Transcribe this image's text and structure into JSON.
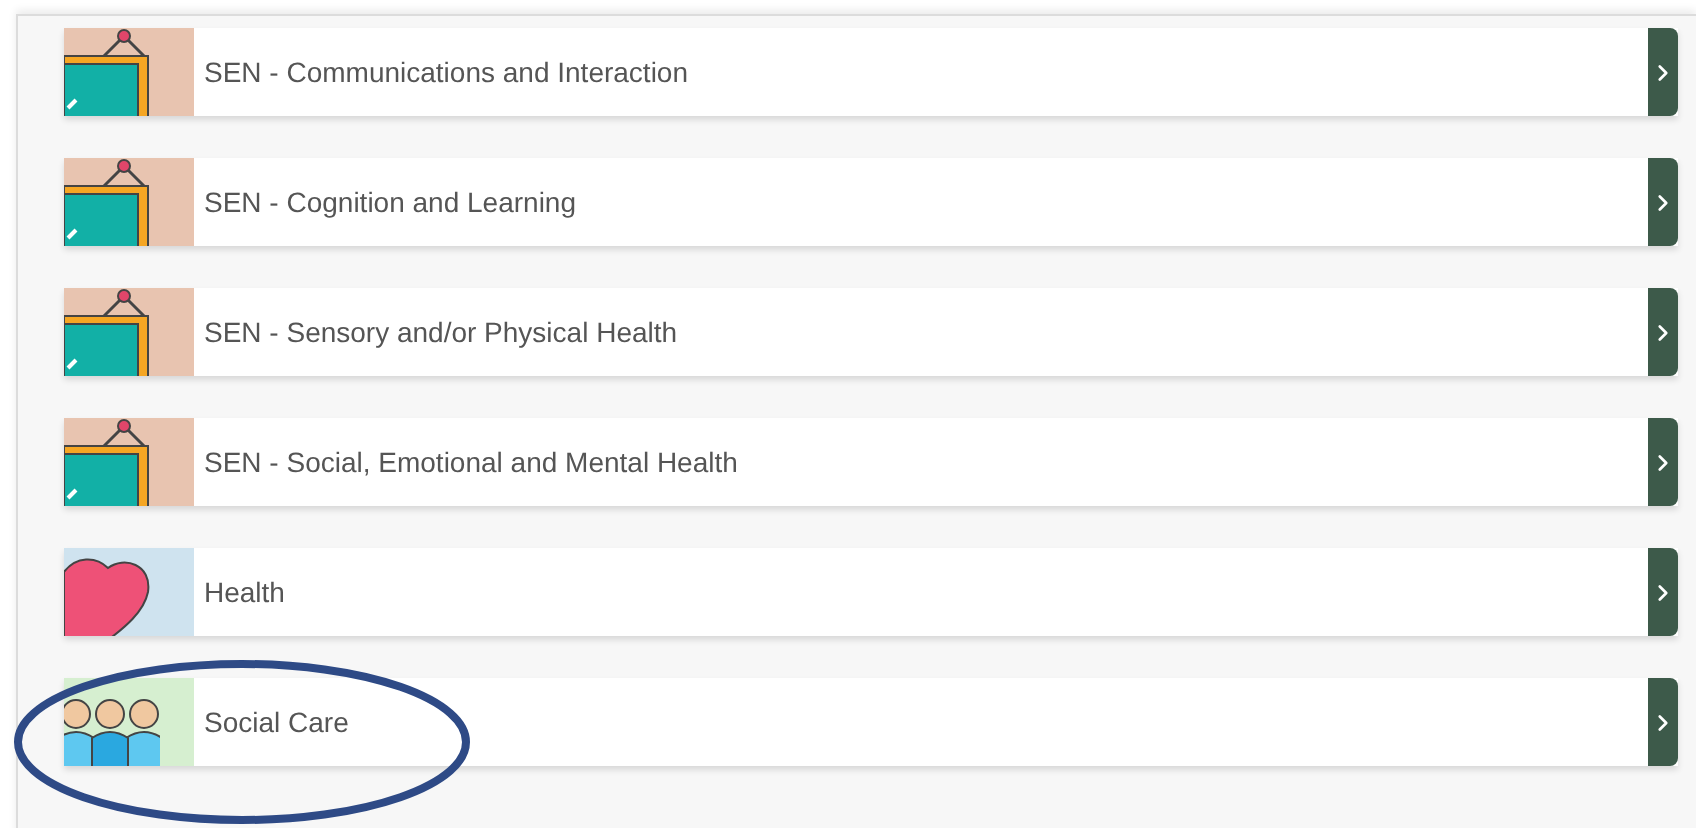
{
  "items": [
    {
      "label": "SEN - Communications and Interaction",
      "kind": "sen",
      "circled": false
    },
    {
      "label": "SEN - Cognition and Learning",
      "kind": "sen",
      "circled": false
    },
    {
      "label": "SEN - Sensory and/or Physical Health",
      "kind": "sen",
      "circled": false
    },
    {
      "label": "SEN - Social, Emotional and Mental Health",
      "kind": "sen",
      "circled": false
    },
    {
      "label": "Health",
      "kind": "health",
      "circled": false
    },
    {
      "label": "Social Care",
      "kind": "social",
      "circled": true
    }
  ]
}
